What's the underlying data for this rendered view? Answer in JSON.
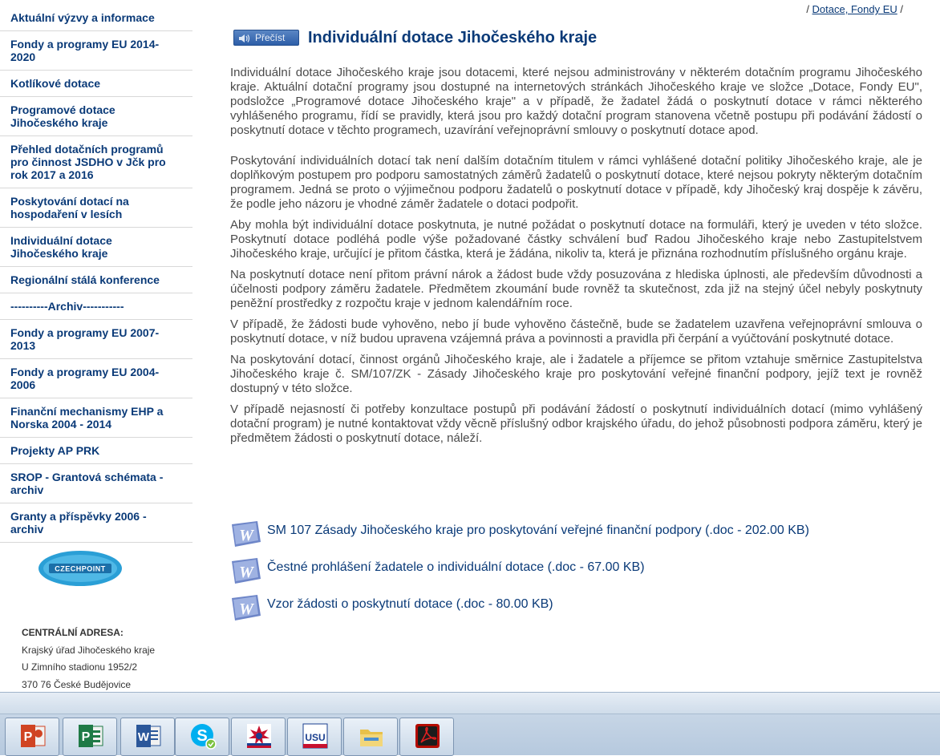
{
  "sidebar": {
    "items": [
      {
        "label": "Aktuální výzvy a informace"
      },
      {
        "label": "Fondy a programy EU 2014-2020"
      },
      {
        "label": "Kotlíkové dotace"
      },
      {
        "label": "Programové dotace Jihočeského kraje"
      },
      {
        "label": "Přehled dotačních programů pro činnost JSDHO v Jčk pro rok 2017 a 2016"
      },
      {
        "label": "Poskytování dotací na hospodaření v lesích"
      },
      {
        "label": "Individuální dotace Jihočeského kraje"
      },
      {
        "label": "Regionální stálá konference"
      },
      {
        "label": "----------Archiv-----------"
      },
      {
        "label": "Fondy a programy EU 2007-2013"
      },
      {
        "label": "Fondy a programy EU 2004-2006"
      },
      {
        "label": "Finanční mechanismy EHP a Norska 2004 - 2014"
      },
      {
        "label": "Projekty AP PRK"
      },
      {
        "label": "SROP - Grantová schémata - archiv"
      },
      {
        "label": "Granty a příspěvky 2006 - archiv"
      }
    ],
    "logo_text": "CZECHPOINT",
    "address": {
      "heading": "CENTRÁLNÍ ADRESA:",
      "line1": "Krajský úřad Jihočeského kraje",
      "line2": "U Zimního stadionu 1952/2",
      "line3": "370 76 České Budějovice"
    }
  },
  "breadcrumb": {
    "prefix": "/ ",
    "link": "Dotace, Fondy EU",
    "suffix": " /"
  },
  "read_button": {
    "label": "Přečíst"
  },
  "page": {
    "title": "Individuální dotace Jihočeského kraje",
    "paragraphs": [
      "Individuální dotace Jihočeského kraje jsou dotacemi, které nejsou administrovány v některém dotačním programu Jihočeského kraje. Aktuální dotační programy jsou dostupné na internetových stránkách Jihočeského kraje ve složce „Dotace, Fondy EU\", podsložce „Programové dotace Jihočeského kraje\" a v případě, že žadatel žádá o poskytnutí dotace v rámci některého vyhlášeného programu, řídí se pravidly, která jsou pro každý dotační program stanovena včetně postupu při podávání žádostí o poskytnutí dotace v těchto programech, uzavírání veřejnoprávní smlouvy o poskytnutí dotace apod.",
      "Poskytování individuálních dotací tak není dalším dotačním titulem v rámci vyhlášené dotační politiky Jihočeského kraje, ale je doplňkovým postupem pro podporu samostatných záměrů žadatelů o poskytnutí dotace, které nejsou pokryty některým dotačním programem. Jedná se proto o výjimečnou podporu žadatelů o poskytnutí dotace v případě, kdy Jihočeský kraj dospěje k závěru, že podle jeho názoru je vhodné záměr žadatele o dotaci podpořit.",
      "Aby mohla být individuální dotace poskytnuta, je nutné požádat o poskytnutí dotace na formuláři, který je uveden v této složce. Poskytnutí dotace podléhá podle výše požadované částky schválení buď Radou Jihočeského kraje nebo Zastupitelstvem Jihočeského kraje, určující je přitom částka, která je žádána, nikoliv ta, která je přiznána rozhodnutím příslušného orgánu kraje.",
      "Na poskytnutí dotace není přitom právní nárok a žádost bude vždy posuzována z hlediska úplnosti, ale především důvodnosti a účelnosti podpory záměru žadatele. Předmětem zkoumání bude rovněž ta skutečnost, zda již na stejný účel nebyly poskytnuty peněžní prostředky z rozpočtu kraje v jednom kalendářním roce.",
      "V případě, že žádosti bude vyhověno, nebo jí bude vyhověno částečně, bude se žadatelem uzavřena veřejnoprávní smlouva o poskytnutí dotace, v níž budou upravena vzájemná práva a povinnosti a pravidla při čerpání a vyúčtování poskytnuté dotace.",
      "Na poskytování dotací, činnost orgánů Jihočeského kraje, ale i žadatele a příjemce se přitom vztahuje směrnice Zastupitelstva Jihočeského kraje č. SM/107/ZK - Zásady Jihočeského kraje pro poskytování veřejné finanční podpory, jejíž text je rovněž dostupný v této složce.",
      "V případě nejasností či potřeby konzultace postupů při podávání žádostí o poskytnutí individuálních dotací (mimo vyhlášený dotační program) je nutné kontaktovat vždy věcně příslušný odbor krajského úřadu, do jehož působnosti podpora záměru, který je předmětem žádosti o poskytnutí dotace, náleží."
    ],
    "files": [
      {
        "label": "SM 107 Zásady Jihočeského kraje pro poskytování veřejné finanční podpory (.doc - 202.00 KB)",
        "icon": "word-doc-icon"
      },
      {
        "label": "Čestné prohlášení žadatele o individuální dotace (.doc - 67.00 KB)",
        "icon": "word-doc-icon"
      },
      {
        "label": "Vzor žádosti o poskytnutí dotace (.doc - 80.00 KB)",
        "icon": "word-doc-icon"
      }
    ]
  },
  "taskbar": {
    "apps": [
      {
        "name": "powerpoint-icon",
        "glyph": "P",
        "color": "#d04423"
      },
      {
        "name": "publisher-icon",
        "glyph": "P",
        "color": "#1f7a46"
      },
      {
        "name": "word-icon",
        "glyph": "W",
        "color": "#2b579a"
      },
      {
        "name": "skype-icon",
        "glyph": "S",
        "color": "#00aff0"
      },
      {
        "name": "jihocesky-app-icon",
        "glyph": "",
        "color": "#c8102e"
      },
      {
        "name": "usu-app-icon",
        "glyph": "USU",
        "color": "#1a3f8f"
      },
      {
        "name": "file-explorer-icon",
        "glyph": "",
        "color": "#e8c14a"
      },
      {
        "name": "acrobat-icon",
        "glyph": "",
        "color": "#b30b00"
      }
    ]
  }
}
